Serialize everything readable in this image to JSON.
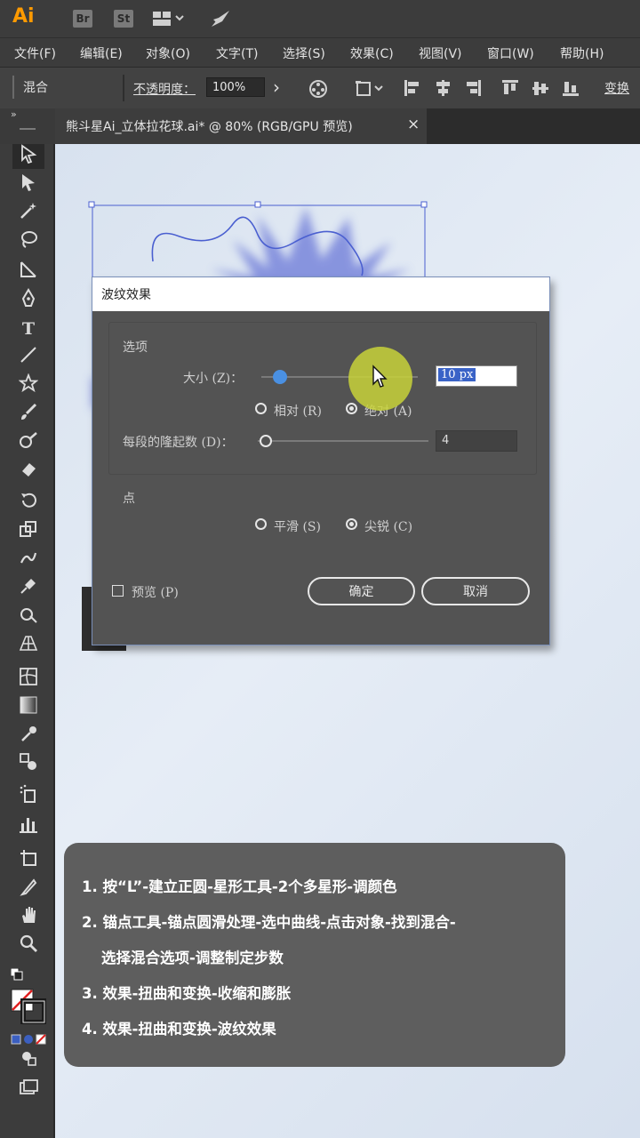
{
  "app": {
    "logo": "Ai",
    "bridge_label": "Br",
    "stock_label": "St"
  },
  "menu": [
    "文件(F)",
    "编辑(E)",
    "对象(O)",
    "文字(T)",
    "选择(S)",
    "效果(C)",
    "视图(V)",
    "窗口(W)",
    "帮助(H)"
  ],
  "control": {
    "blend_label": "混合",
    "opacity_label": "不透明度：",
    "opacity_value": "100%",
    "arrow": "›",
    "transform_label": "变换"
  },
  "tab": {
    "title": "熊斗星Ai_立体拉花球.ai* @ 80% (RGB/GPU 预览)",
    "close": "×"
  },
  "dialog": {
    "title": "波纹效果",
    "options_heading": "选项",
    "size_label": "大小 (Z)：",
    "size_value": "10 px",
    "size_fraction": 0.12,
    "relative_label": "相对 (R)",
    "absolute_label": "绝对 (A)",
    "ridges_label": "每段的隆起数 (D)：",
    "ridges_value": "4",
    "points_heading": "点",
    "smooth_label": "平滑 (S)",
    "corner_label": "尖锐 (C)",
    "preview_label": "预览 (P)",
    "ok_label": "确定",
    "cancel_label": "取消"
  },
  "notes": [
    "1. 按“L”-建立正圆-星形工具-2个多星形-调颜色",
    "2. 锚点工具-锚点圆滑处理-选中曲线-点击对象-找到混合-",
    "选择混合选项-调整制定步数",
    "3. 效果-扭曲和变换-收缩和膨胀",
    "4. 效果-扭曲和变换-波纹效果"
  ],
  "colors": {
    "logo": "#ff9a00",
    "selection": "#4a5fd0",
    "slider_thumb": "#4a90e2",
    "cursor_highlight": "#c8d23a"
  }
}
